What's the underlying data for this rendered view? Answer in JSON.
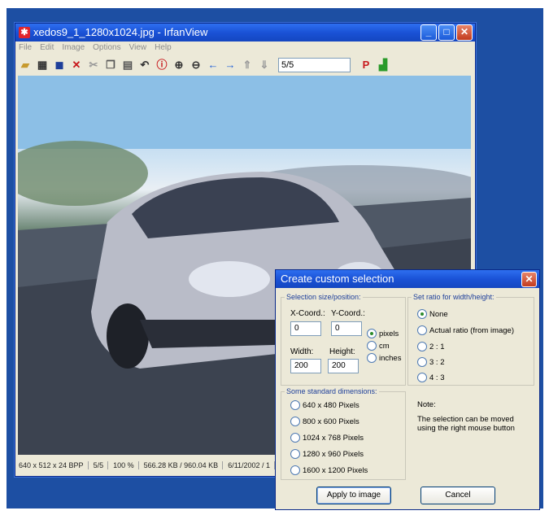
{
  "window": {
    "title": "xedos9_1_1280x1024.jpg - IrfanView",
    "app_icon": "irfanview-red-cat-icon"
  },
  "menu": [
    "File",
    "Edit",
    "Image",
    "Options",
    "View",
    "Help"
  ],
  "toolbar": {
    "icons": [
      "open-icon",
      "thumbnails-icon",
      "save-icon",
      "delete-icon",
      "cut-icon",
      "copy-icon",
      "paste-icon",
      "undo-icon",
      "info-icon",
      "zoom-in-icon",
      "zoom-out-icon",
      "previous-icon",
      "next-icon",
      "first-icon",
      "last-icon"
    ],
    "page_field": "5/5",
    "print_icon": "P"
  },
  "statusbar": {
    "dimensions": "640 x 512 x 24 BPP",
    "page": "5/5",
    "zoom": "100 %",
    "size": "566.28 KB / 960.04 KB",
    "date": "6/11/2002 / 1"
  },
  "dialog": {
    "title": "Create custom selection",
    "size_group": "Selection size/position:",
    "xcoord_label": "X-Coord.:",
    "ycoord_label": "Y-Coord.:",
    "xcoord_value": "0",
    "ycoord_value": "0",
    "width_label": "Width:",
    "height_label": "Height:",
    "width_value": "200",
    "height_value": "200",
    "units": [
      "pixels",
      "cm",
      "inches"
    ],
    "units_selected": "pixels",
    "ratio_group": "Set ratio for width/height:",
    "ratios": [
      "None",
      "Actual ratio (from image)",
      "2 : 1",
      "3 : 2",
      "4 : 3"
    ],
    "ratio_selected": "None",
    "standard_group": "Some standard dimensions:",
    "standard_dims": [
      "640 x 480 Pixels",
      "800 x 600 Pixels",
      "1024 x 768 Pixels",
      "1280 x 960 Pixels",
      "1600 x 1200 Pixels"
    ],
    "note_title": "Note:",
    "note_text": "The selection can be moved using the right mouse button",
    "apply_label": "Apply to image",
    "cancel_label": "Cancel"
  }
}
